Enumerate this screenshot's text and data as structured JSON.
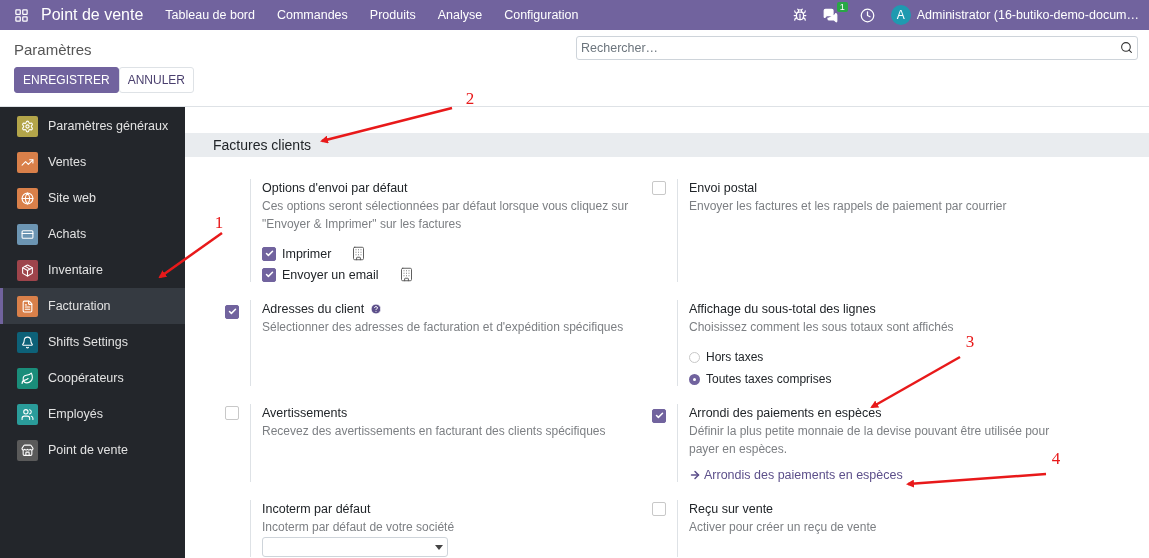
{
  "navbar": {
    "brand": "Point de vente",
    "menu": [
      "Tableau de bord",
      "Commandes",
      "Produits",
      "Analyse",
      "Configuration"
    ],
    "messages_badge": "1",
    "user_initial": "A",
    "user_name": "Administrator (16-butiko-demo-docum…"
  },
  "control_panel": {
    "title": "Paramètres",
    "buttons": [
      {
        "label": "ENREGISTRER",
        "kind": "primary"
      },
      {
        "label": "ANNULER",
        "kind": "secondary"
      }
    ],
    "search": {
      "placeholder": "Rechercher…"
    }
  },
  "sidebar": {
    "items": [
      {
        "label": "Paramètres généraux",
        "color": "#b3a54a",
        "selected": false
      },
      {
        "label": "Ventes",
        "color": "#d9804a",
        "selected": false
      },
      {
        "label": "Site web",
        "color": "#d9804a",
        "selected": false
      },
      {
        "label": "Achats",
        "color": "#6c95b3",
        "selected": false
      },
      {
        "label": "Inventaire",
        "color": "#9e444b",
        "selected": false
      },
      {
        "label": "Facturation",
        "color": "#d9804a",
        "selected": true
      },
      {
        "label": "Shifts Settings",
        "color": "#0d6178",
        "selected": false
      },
      {
        "label": "Coopérateurs",
        "color": "#1a8d7a",
        "selected": false
      },
      {
        "label": "Employés",
        "color": "#2a9c9a",
        "selected": false
      },
      {
        "label": "Point de vente",
        "color": "#5a5a5a",
        "selected": false
      }
    ]
  },
  "section": {
    "title": "Factures clients",
    "settings": [
      {
        "kind": "plain",
        "title": "Options d'envoi par défaut",
        "description": "Ces options seront sélectionnées par défaut lorsque vous cliquez sur \"Envoyer & Imprimer\" sur les factures",
        "options": [
          {
            "label": "Imprimer",
            "checked": true
          },
          {
            "label": "Envoyer un email",
            "checked": true
          }
        ]
      },
      {
        "kind": "checkbox",
        "checked": false,
        "title": "Envoi postal",
        "description": "Envoyer les factures et les rappels de paiement par courrier"
      },
      {
        "kind": "checkbox",
        "checked": true,
        "title": "Adresses du client",
        "help": true,
        "description": "Sélectionner des adresses de facturation et d'expédition spécifiques"
      },
      {
        "kind": "plain",
        "title": "Affichage du sous-total des lignes",
        "description": "Choisissez comment les sous totaux sont affichés",
        "radios": [
          {
            "label": "Hors taxes",
            "selected": false
          },
          {
            "label": "Toutes taxes comprises",
            "selected": true
          }
        ]
      },
      {
        "kind": "checkbox",
        "checked": false,
        "title": "Avertissements",
        "description": "Recevez des avertissements en facturant des clients spécifiques"
      },
      {
        "kind": "checkbox",
        "checked": true,
        "title": "Arrondi des paiements en espèces",
        "description": "Définir la plus petite monnaie de la devise pouvant être utilisée pour payer en espèces.",
        "link": "Arrondis des paiements en espèces"
      },
      {
        "kind": "select",
        "title": "Incoterm par défaut",
        "description": "Incoterm par défaut de votre société"
      },
      {
        "kind": "checkbox",
        "checked": false,
        "title": "Reçu sur vente",
        "description": "Activer pour créer un reçu de vente"
      }
    ]
  },
  "annotations": [
    {
      "label": "1"
    },
    {
      "label": "2"
    },
    {
      "label": "3"
    },
    {
      "label": "4"
    }
  ]
}
